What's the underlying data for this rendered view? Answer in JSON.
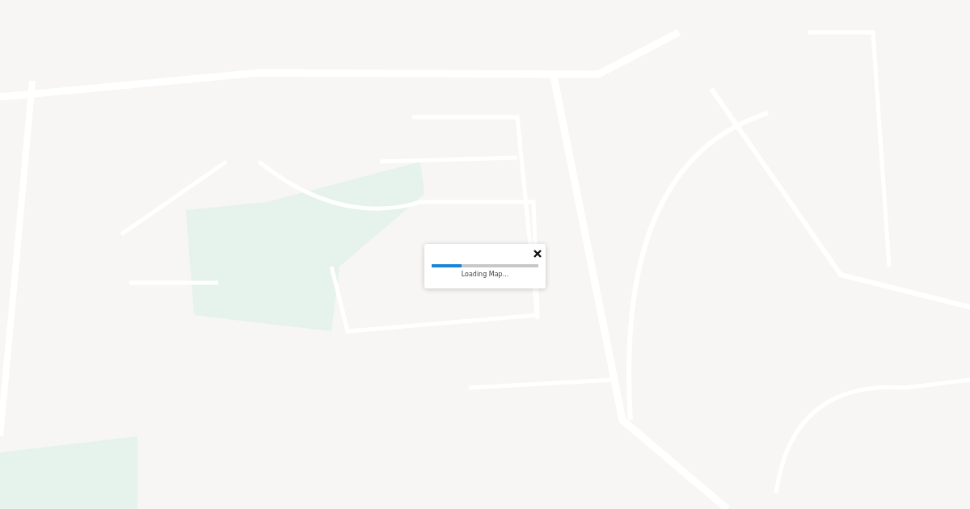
{
  "loading_dialog": {
    "progress": {
      "level": 0.28
    },
    "message": "Loading Map..."
  }
}
